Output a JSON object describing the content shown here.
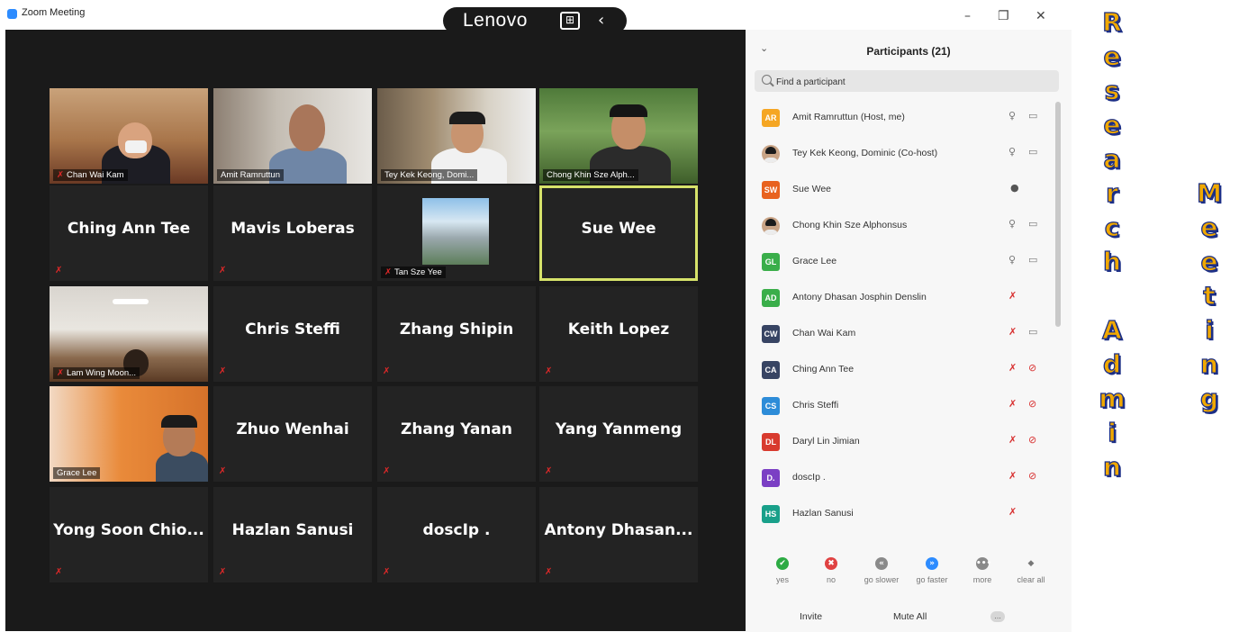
{
  "window": {
    "title": "Zoom Meeting",
    "laptop_brand": "Lenovo",
    "minimize": "–",
    "restore": "❐",
    "close": "✕"
  },
  "gallery": {
    "tiles": [
      {
        "name": "Chan Wai Kam",
        "type": "video",
        "scene": "office"
      },
      {
        "name": "Amit Ramruttun",
        "type": "video",
        "scene": "room"
      },
      {
        "name": "Tey Kek Keong, Domi...",
        "type": "video",
        "scene": "shelves"
      },
      {
        "name": "Chong Khin Sze Alph...",
        "type": "video",
        "scene": "trees"
      },
      {
        "name": "Ching Ann Tee",
        "type": "text"
      },
      {
        "name": "Mavis Loberas",
        "type": "text"
      },
      {
        "name": "Tan Sze Yee",
        "type": "image",
        "scene": "mountain"
      },
      {
        "name": "Sue Wee",
        "type": "text",
        "active": true
      },
      {
        "name": "Lam Wing Moon...",
        "type": "video",
        "scene": "lamp"
      },
      {
        "name": "Chris Steffi",
        "type": "text"
      },
      {
        "name": "Zhang Shipin",
        "type": "text"
      },
      {
        "name": "Keith Lopez",
        "type": "text"
      },
      {
        "name": "Grace Lee",
        "type": "video",
        "scene": "orange"
      },
      {
        "name": "Zhuo Wenhai",
        "type": "text"
      },
      {
        "name": "Zhang Yanan",
        "type": "text"
      },
      {
        "name": "Yang Yanmeng",
        "type": "text"
      },
      {
        "name": "Yong Soon Chio...",
        "type": "text"
      },
      {
        "name": "Hazlan Sanusi",
        "type": "text"
      },
      {
        "name": "doscIp .",
        "type": "text"
      },
      {
        "name": "Antony  Dhasan...",
        "type": "text"
      }
    ]
  },
  "participants": {
    "title": "Participants (21)",
    "search_placeholder": "Find a participant",
    "list": [
      {
        "initials": "AR",
        "color": "#f5a623",
        "name": "Amit Ramruttun (Host, me)",
        "mic": "on",
        "cam": "on"
      },
      {
        "photo": true,
        "name": "Tey Kek Keong, Dominic (Co-host)",
        "mic": "on",
        "cam": "on"
      },
      {
        "initials": "SW",
        "color": "#e8621f",
        "name": "Sue Wee",
        "mic": "talking",
        "cam": "none"
      },
      {
        "photo": true,
        "name": "Chong Khin Sze Alphonsus",
        "mic": "on",
        "cam": "on"
      },
      {
        "initials": "GL",
        "color": "#3aae4a",
        "name": "Grace Lee",
        "mic": "on",
        "cam": "on"
      },
      {
        "initials": "AD",
        "color": "#3aae4a",
        "name": "Antony Dhasan Josphin Denslin",
        "mic": "muted",
        "cam": "none"
      },
      {
        "initials": "CW",
        "color": "#374463",
        "name": "Chan Wai Kam",
        "mic": "muted",
        "cam": "on"
      },
      {
        "initials": "CA",
        "color": "#374463",
        "name": "Ching Ann Tee",
        "mic": "muted",
        "cam": "off"
      },
      {
        "initials": "CS",
        "color": "#2d8cd8",
        "name": "Chris Steffi",
        "mic": "muted",
        "cam": "off"
      },
      {
        "initials": "DL",
        "color": "#d83a2e",
        "name": "Daryl Lin Jimian",
        "mic": "muted",
        "cam": "off"
      },
      {
        "initials": "D.",
        "color": "#7b3fc4",
        "name": "doscIp .",
        "mic": "muted",
        "cam": "off"
      },
      {
        "initials": "HS",
        "color": "#19a08a",
        "name": "Hazlan Sanusi",
        "mic": "muted",
        "cam": "none"
      }
    ],
    "reactions": [
      {
        "label": "yes",
        "color": "#2dab44",
        "glyph": "✔"
      },
      {
        "label": "no",
        "color": "#e04242",
        "glyph": "✖"
      },
      {
        "label": "go slower",
        "color": "#8a8a8a",
        "glyph": "«"
      },
      {
        "label": "go faster",
        "color": "#2d8cff",
        "glyph": "»"
      },
      {
        "label": "more",
        "color": "#8a8a8a",
        "glyph": "•••"
      },
      {
        "label": "clear all",
        "color": "#8a8a8a",
        "glyph": "◆"
      }
    ],
    "invite_label": "Invite",
    "mute_all_label": "Mute All",
    "more_label": "..."
  },
  "overlay": {
    "word1": "Research",
    "word2": "Admin",
    "word3": "Meeting"
  }
}
